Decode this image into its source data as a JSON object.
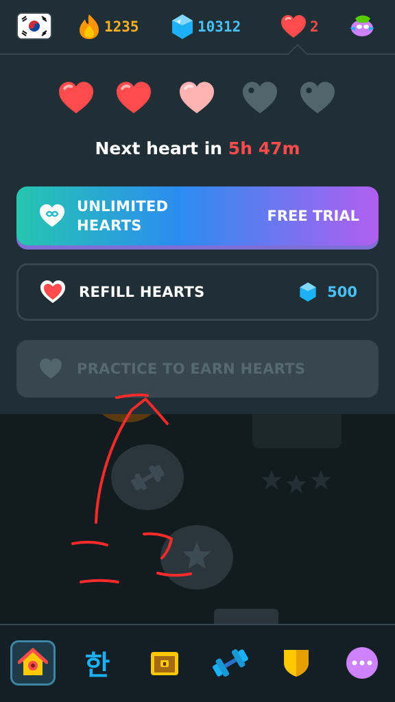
{
  "topbar": {
    "course_flag_icon": "south-korea-flag-icon",
    "streak_count": "1235",
    "gems_count": "10312",
    "hearts_count": "2",
    "colors": {
      "streak": "#ffb020",
      "gems": "#49c0f8",
      "hearts": "#ff4b4b"
    }
  },
  "hearts_panel": {
    "hearts": [
      {
        "state": "full"
      },
      {
        "state": "full"
      },
      {
        "state": "refilling"
      },
      {
        "state": "empty"
      },
      {
        "state": "empty"
      }
    ],
    "next_heart_prefix": "Next heart in",
    "next_heart_time": "5h 47m",
    "unlimited": {
      "label_line1": "UNLIMITED",
      "label_line2": "HEARTS",
      "action": "FREE TRIAL",
      "icon": "infinity-heart-icon"
    },
    "refill": {
      "label": "REFILL HEARTS",
      "cost": "500",
      "icon": "heart-icon",
      "cost_icon": "gem-icon"
    },
    "practice": {
      "label": "PRACTICE TO EARN HEARTS",
      "icon": "heart-outline-icon",
      "disabled": true
    }
  },
  "annotation": {
    "handwritten_text": "ここ",
    "color": "#ff2a2a"
  },
  "bottom_nav": {
    "items": [
      {
        "name": "home",
        "icon": "home-icon",
        "active": true
      },
      {
        "name": "characters",
        "glyph": "한"
      },
      {
        "name": "treasure",
        "icon": "treasure-chest-icon"
      },
      {
        "name": "practice",
        "icon": "dumbbell-icon"
      },
      {
        "name": "leagues",
        "icon": "shield-icon"
      },
      {
        "name": "more",
        "icon": "more-icon"
      }
    ]
  }
}
